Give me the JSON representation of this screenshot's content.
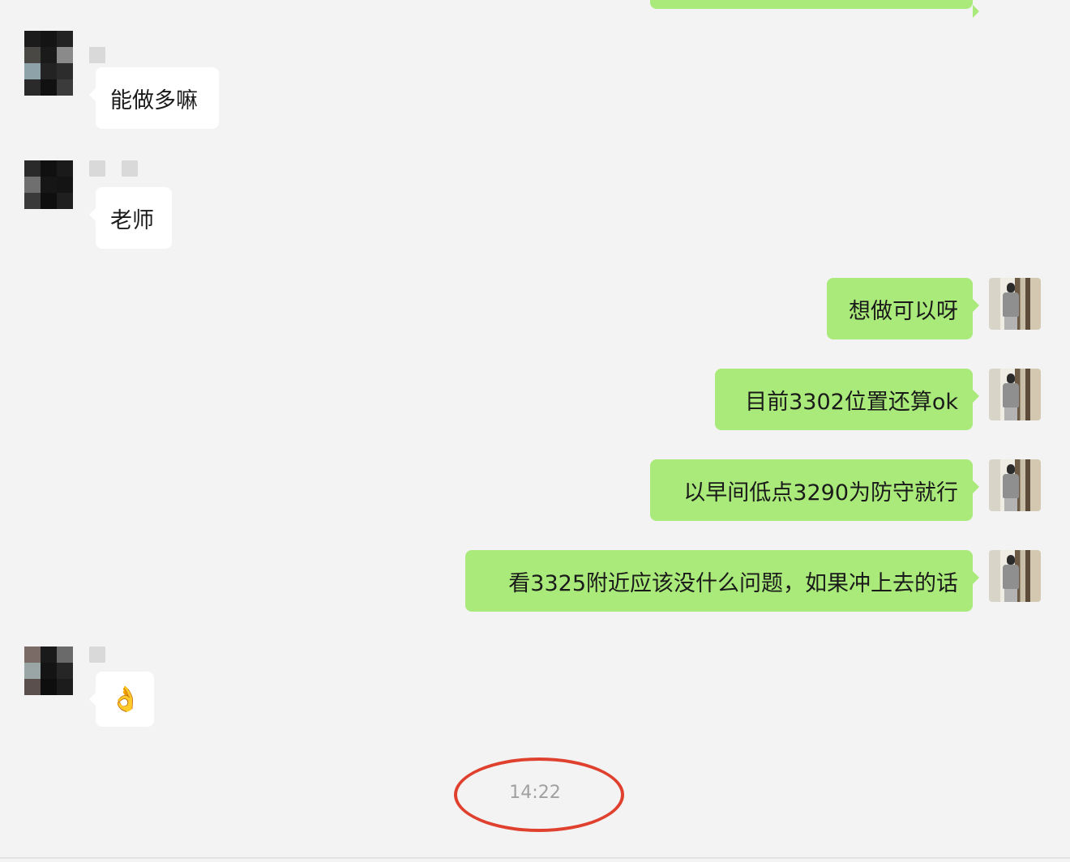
{
  "chat": {
    "top_partial_bubble": {
      "text": ""
    },
    "messages": [
      {
        "side": "in",
        "text": "能做多嘛"
      },
      {
        "side": "in",
        "text": "老师"
      },
      {
        "side": "out",
        "text": "想做可以呀"
      },
      {
        "side": "out",
        "text": "目前3302位置还算ok"
      },
      {
        "side": "out",
        "text": "以早间低点3290为防守就行"
      },
      {
        "side": "out",
        "text": "看3325附近应该没什么问题，如果冲上去的话"
      },
      {
        "side": "in",
        "text": "👌"
      }
    ],
    "timestamp": "14:22"
  },
  "colors": {
    "background": "#f3f3f3",
    "incoming_bubble": "#ffffff",
    "outgoing_bubble": "#a9ea7a",
    "highlight_ring": "#e0412f",
    "timestamp_text": "#a0a0a0"
  }
}
